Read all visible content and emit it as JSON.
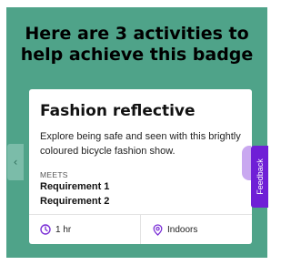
{
  "heading": "Here are 3 activities to help achieve this badge",
  "card": {
    "title": "Fashion reflective",
    "description": "Explore being safe and seen with this brightly coloured bicycle fashion show.",
    "meets_label": "MEETS",
    "requirements": [
      "Requirement 1",
      "Requirement 2"
    ],
    "duration": "1 hr",
    "location": "Indoors"
  },
  "carousel": {
    "prev_icon": "‹"
  },
  "feedback_label": "Feedback",
  "colors": {
    "panel_bg": "#4fa389",
    "accent_purple": "#6f1fd6",
    "card_bg": "#ffffff"
  },
  "icons": {
    "duration": "clock-icon",
    "location": "location-pin-icon",
    "prev": "chevron-left-icon"
  }
}
